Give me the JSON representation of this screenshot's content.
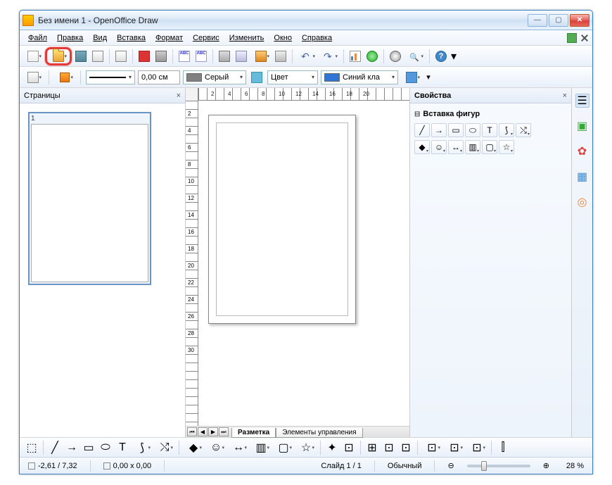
{
  "window": {
    "title": "Без имени 1 - OpenOffice Draw"
  },
  "menu": {
    "file": "Файл",
    "edit": "Правка",
    "view": "Вид",
    "insert": "Вставка",
    "format": "Формат",
    "service": "Сервис",
    "modify": "Изменить",
    "window": "Окно",
    "help": "Справка"
  },
  "toolbar1": {
    "abc1": "ABC",
    "abc2": "ABC",
    "help": "?"
  },
  "toolbar2": {
    "line_width": "0,00 см",
    "color_gray_label": "Серый",
    "color_fill_label": "Цвет",
    "color_blue_label": "Синий кла"
  },
  "pages": {
    "title": "Страницы",
    "num": "1"
  },
  "ruler_h": [
    "2",
    "4",
    "6",
    "8",
    "10",
    "12",
    "14",
    "16",
    "18",
    "20"
  ],
  "ruler_v": [
    "2",
    "4",
    "6",
    "8",
    "10",
    "12",
    "14",
    "16",
    "18",
    "20",
    "22",
    "24",
    "26",
    "28",
    "30"
  ],
  "tabs": {
    "layout": "Разметка",
    "controls": "Элементы управления"
  },
  "props": {
    "title": "Свойства",
    "section_shapes": "Вставка фигур"
  },
  "shapes": {
    "line": "╱",
    "arrow": "→",
    "rect": "▭",
    "ellipse": "⬭",
    "text": "T",
    "curve": "⟆",
    "conn": "⤭",
    "diamond": "◆",
    "smiley": "☺",
    "arr2": "↔",
    "cube": "▥",
    "callout": "▢",
    "star": "☆"
  },
  "bottom": {
    "cursor": "⬚",
    "line": "╱",
    "arrow": "→",
    "rect": "▭",
    "ellipse": "⬭",
    "text": "T",
    "curve": "⟆",
    "conn": "⤭",
    "shape": "◆",
    "sym": "☺",
    "arr": "↔",
    "flow": "▥",
    "call": "▢",
    "star": "☆",
    "pts": "✦",
    "glue": "⊡",
    "font": "⊞",
    "img": "⊡",
    "gal": "⊡",
    "effect": "⊡",
    "align": "⊡",
    "arr2": "⊡",
    "ext": "⫿"
  },
  "status": {
    "pos": "-2,61 / 7,32",
    "size": "0,00 x 0,00",
    "slide": "Слайд 1 / 1",
    "mode": "Обычный",
    "zoom": "28 %"
  },
  "colors": {
    "gray": "#808080",
    "blue": "#2e75d6"
  }
}
